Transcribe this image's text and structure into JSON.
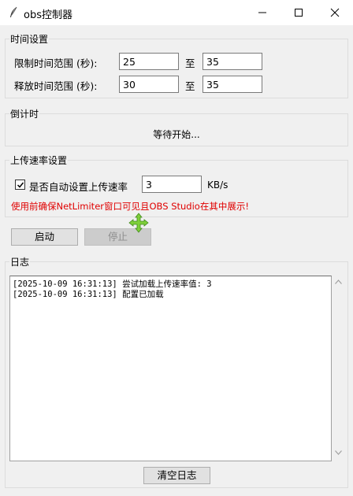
{
  "window": {
    "title": "obs控制器",
    "icon": "feather-icon",
    "controls": [
      "minimize-icon",
      "maximize-icon",
      "close-icon"
    ]
  },
  "time_settings": {
    "legend": "时间设置",
    "limit_label": "限制时间范围 (秒):",
    "limit_min": "25",
    "limit_max": "35",
    "release_label": "释放时间范围 (秒):",
    "release_min": "30",
    "release_max": "35",
    "separator": "至"
  },
  "countdown": {
    "legend": "倒计时",
    "status": "等待开始..."
  },
  "upload": {
    "legend": "上传速率设置",
    "auto_checked": true,
    "auto_label": "是否自动设置上传速率",
    "rate_value": "3",
    "unit": "KB/s",
    "warning": "使用前确保NetLimiter窗口可见且OBS Studio在其中展示!",
    "warning_color": "#e00000"
  },
  "controls": {
    "start_label": "启动",
    "stop_label": "停止",
    "stop_disabled": true
  },
  "log": {
    "legend": "日志",
    "lines": [
      "[2025-10-09 16:31:13] 尝试加载上传速率值: 3",
      "[2025-10-09 16:31:13] 配置已加载"
    ],
    "clear_label": "清空日志"
  }
}
